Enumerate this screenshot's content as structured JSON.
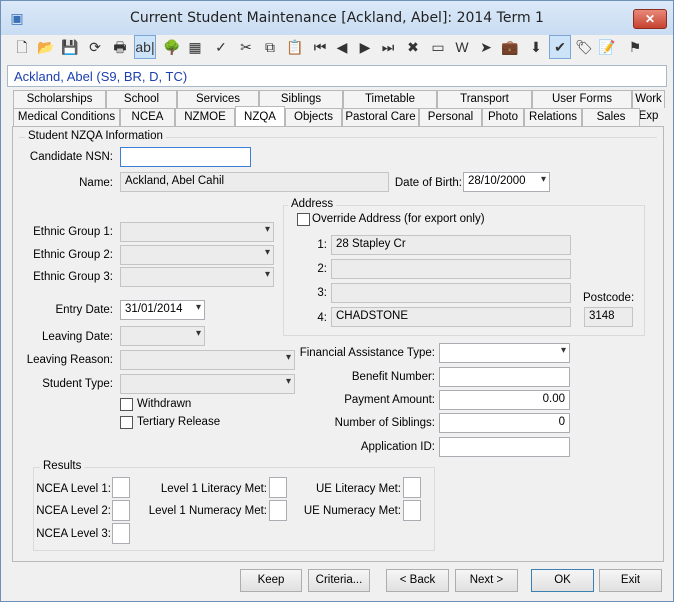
{
  "window": {
    "title": "Current Student Maintenance  [Ackland, Abel]:  2014 Term 1",
    "close_label": "✕"
  },
  "student_header": "Ackland, Abel (S9, BR, D, TC)",
  "toolbar": [
    {
      "name": "new-icon",
      "glyph": "🗋"
    },
    {
      "name": "open-folder-icon",
      "glyph": "📂"
    },
    {
      "name": "save-icon",
      "glyph": "💾"
    },
    {
      "name": "refresh-icon",
      "glyph": "⟳"
    },
    {
      "name": "print-icon",
      "glyph": "🖶"
    },
    {
      "name": "field-icon",
      "glyph": "ab|"
    },
    {
      "name": "tree-icon",
      "glyph": "🌳"
    },
    {
      "name": "calculator-icon",
      "glyph": "▦"
    },
    {
      "name": "spellcheck-icon",
      "glyph": "✓"
    },
    {
      "name": "cut-icon",
      "glyph": "✂"
    },
    {
      "name": "copy-icon",
      "glyph": "⧉"
    },
    {
      "name": "paste-icon",
      "glyph": "📋"
    },
    {
      "name": "first-record-icon",
      "glyph": "⏮"
    },
    {
      "name": "previous-record-icon",
      "glyph": "◀"
    },
    {
      "name": "next-record-icon",
      "glyph": "▶"
    },
    {
      "name": "last-record-icon",
      "glyph": "⏭"
    },
    {
      "name": "delete-icon",
      "glyph": "✖"
    },
    {
      "name": "card-icon",
      "glyph": "▭"
    },
    {
      "name": "word-icon",
      "glyph": "W"
    },
    {
      "name": "forward-icon",
      "glyph": "➤"
    },
    {
      "name": "briefcase-icon",
      "glyph": "💼"
    },
    {
      "name": "download-icon",
      "glyph": "⬇"
    },
    {
      "name": "approve-icon",
      "glyph": "✔"
    },
    {
      "name": "tag-icon",
      "glyph": "🏷"
    },
    {
      "name": "clipboard-check-icon",
      "glyph": "📝"
    },
    {
      "name": "flag-icon",
      "glyph": "⚑"
    }
  ],
  "tabs_row1": [
    "Scholarships",
    "School",
    "Services",
    "Siblings",
    "Timetable",
    "Transport",
    "User Forms",
    "Work Exp"
  ],
  "tabs_row2": [
    "Medical Conditions",
    "NCEA",
    "NZMOE",
    "NZQA",
    "Objects",
    "Pastoral Care",
    "Personal",
    "Photo",
    "Relations",
    "Sales"
  ],
  "selected_tab": "NZQA",
  "nzqa": {
    "section_title": "Student NZQA Information",
    "candidate_nsn_label": "Candidate NSN:",
    "candidate_nsn_value": "",
    "name_label": "Name:",
    "name_value": "Ackland, Abel Cahil",
    "dob_label": "Date of Birth:",
    "dob_value": "28/10/2000",
    "ethnic1_label": "Ethnic Group 1:",
    "ethnic2_label": "Ethnic Group 2:",
    "ethnic3_label": "Ethnic Group 3:",
    "ethnic1_value": "",
    "ethnic2_value": "",
    "ethnic3_value": "",
    "entry_date_label": "Entry Date:",
    "entry_date_value": "31/01/2014",
    "leaving_date_label": "Leaving Date:",
    "leaving_date_value": "",
    "leaving_reason_label": "Leaving Reason:",
    "leaving_reason_value": "",
    "student_type_label": "Student Type:",
    "student_type_value": "",
    "withdrawn_label": "Withdrawn",
    "withdrawn_checked": false,
    "tertiary_label": "Tertiary Release",
    "tertiary_checked": false
  },
  "address": {
    "title": "Address",
    "override_label": "Override Address (for export only)",
    "override_checked": false,
    "line1_label": "1:",
    "line2_label": "2:",
    "line3_label": "3:",
    "line4_label": "4:",
    "line1": "28 Stapley Cr",
    "line2": "",
    "line3": "",
    "line4": "CHADSTONE",
    "postcode_label": "Postcode:",
    "postcode": "3148"
  },
  "finance": {
    "assistance_label": "Financial Assistance Type:",
    "assistance_value": "",
    "benefit_label": "Benefit Number:",
    "benefit_value": "",
    "payment_label": "Payment Amount:",
    "payment_value": "0.00",
    "siblings_label": "Number of Siblings:",
    "siblings_value": "0",
    "application_label": "Application ID:",
    "application_value": ""
  },
  "results": {
    "title": "Results",
    "ncea1": "NCEA Level 1:",
    "ncea2": "NCEA Level 2:",
    "ncea3": "NCEA Level 3:",
    "lit1": "Level 1 Literacy Met:",
    "num1": "Level 1 Numeracy Met:",
    "ue_lit": "UE Literacy Met:",
    "ue_num": "UE Numeracy Met:"
  },
  "buttons": {
    "keep": "Keep",
    "criteria": "Criteria...",
    "back": "< Back",
    "next": "Next >",
    "ok": "OK",
    "exit": "Exit"
  }
}
